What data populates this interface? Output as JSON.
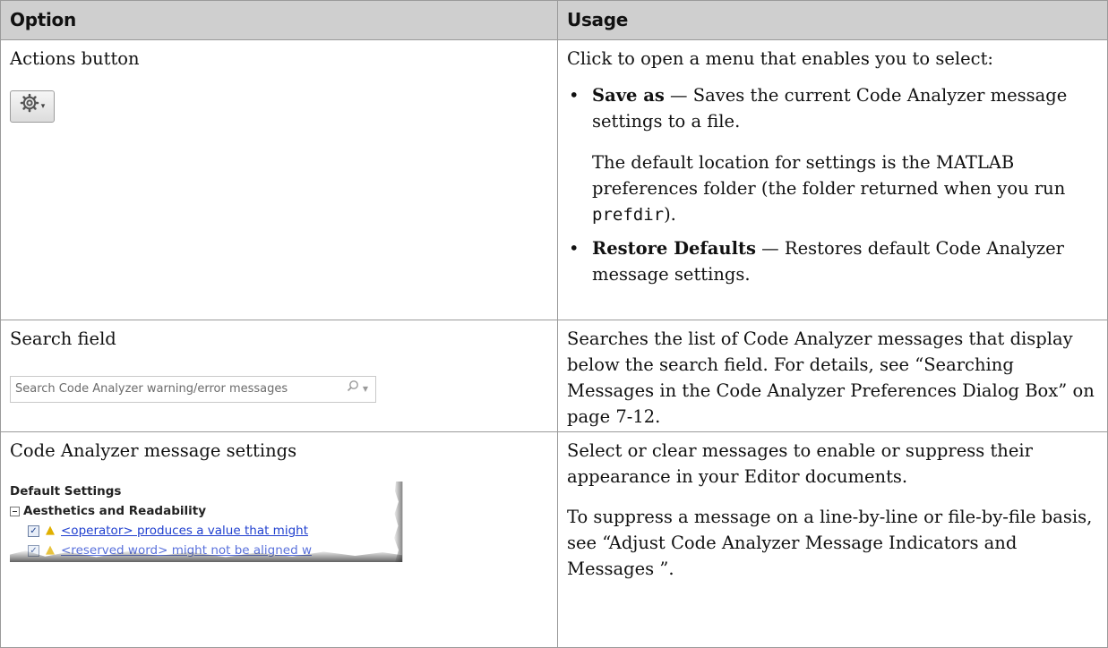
{
  "table": {
    "headers": {
      "option": "Option",
      "usage": "Usage"
    },
    "rows": [
      {
        "option": "Actions button",
        "usage": {
          "intro": "Click to open a menu that enables you to select:",
          "bullets": [
            {
              "term": "Save as",
              "sep": " — ",
              "text": "Saves the current Code Analyzer message settings to a file.",
              "extra_before": "The default location for settings is the MATLAB preferences folder (the folder returned when you run ",
              "extra_code": "prefdir",
              "extra_after": ")."
            },
            {
              "term": "Restore Defaults",
              "sep": " — ",
              "text": "Restores default Code Analyzer message settings."
            }
          ]
        }
      },
      {
        "option": "Search field",
        "usage": "Searches the list of Code Analyzer messages that display below the search field. For details, see “Searching Messages in the Code Analyzer Preferences Dialog Box” on page 7-12."
      },
      {
        "option": "Code Analyzer message settings",
        "usage": {
          "p1": "Select or clear messages to enable or suppress their appearance in your Editor documents.",
          "p2": "To suppress a message on a line-by-line or file-by-file basis, see “Adjust Code Analyzer Message Indicators and Messages ”."
        }
      }
    ]
  },
  "search_widget": {
    "placeholder": "Search Code Analyzer warning/error messages"
  },
  "settings_snippet": {
    "default_label": "Default Settings",
    "group_label": "Aesthetics and Readability",
    "rows": [
      "<operator> produces a value that might",
      "<reserved word> might not be aligned w"
    ]
  },
  "icons": {
    "actions": "gear-icon",
    "search": "magnifier-icon",
    "warning": "warning-triangle-icon"
  },
  "colors": {
    "header_bg": "#cfcfcf",
    "link": "#1f3fcf",
    "warning": "#e0b000"
  }
}
